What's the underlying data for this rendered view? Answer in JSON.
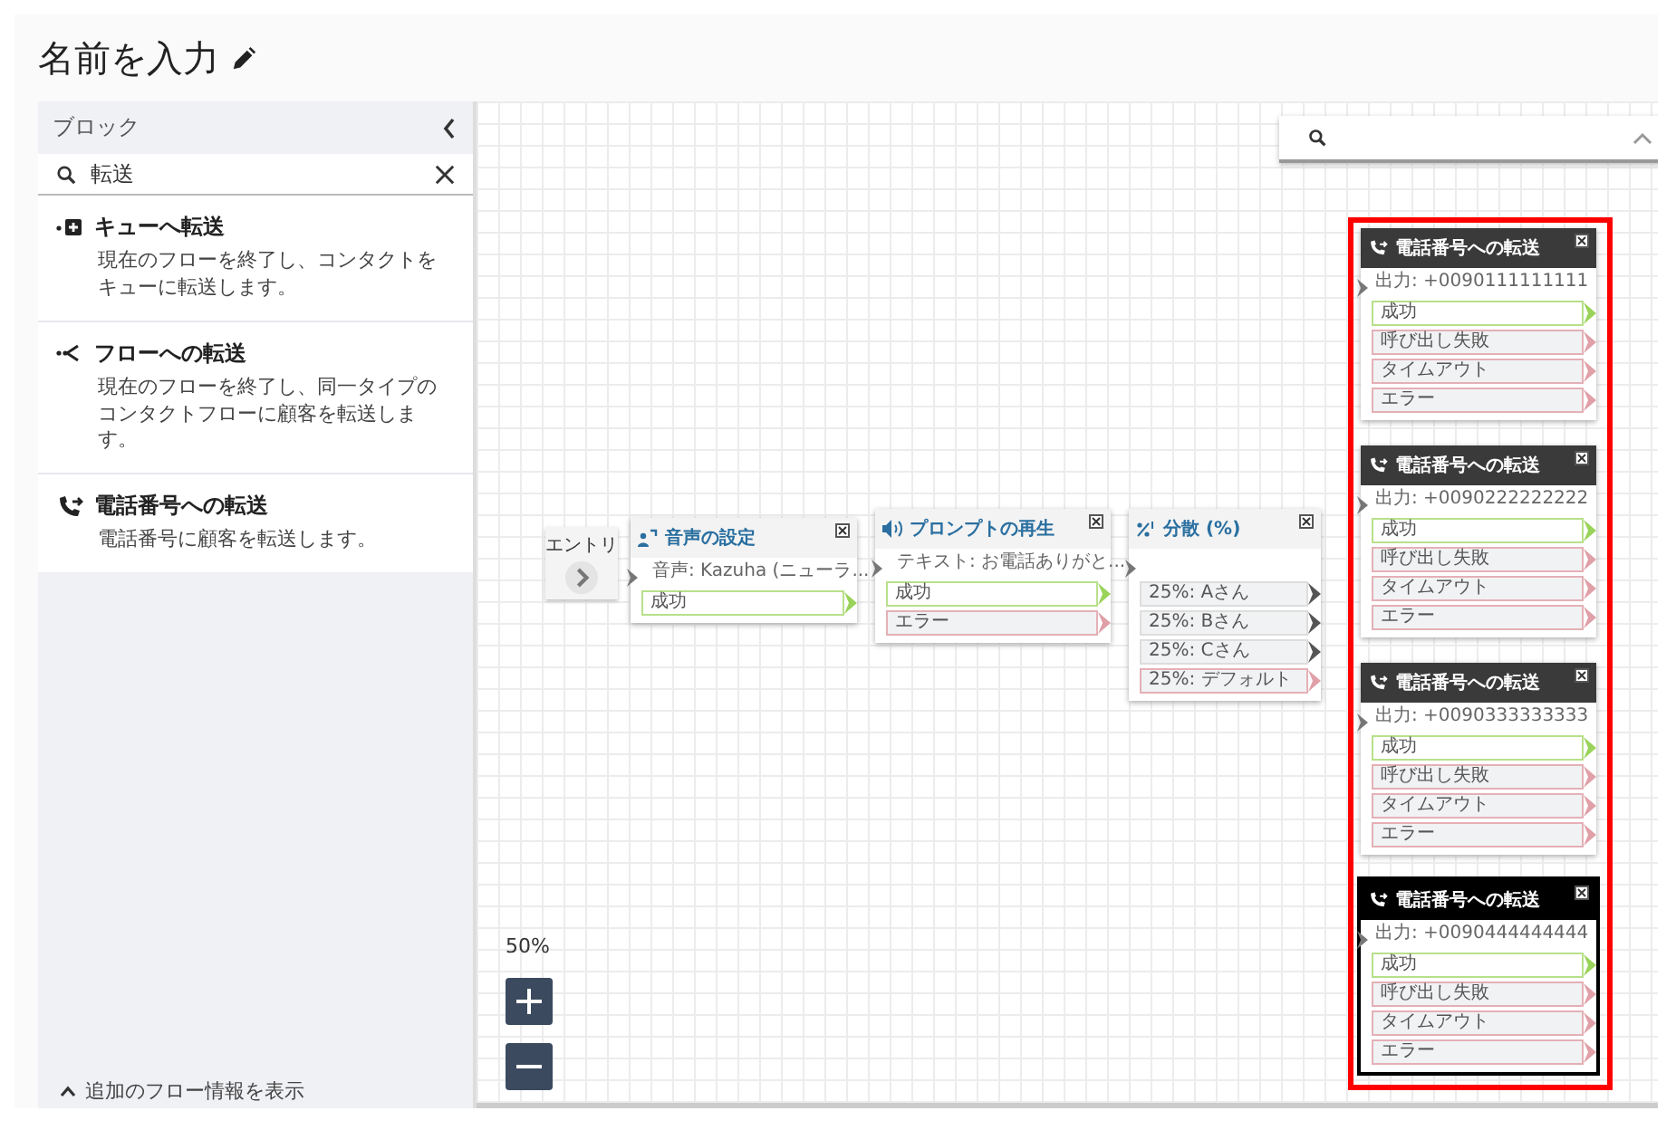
{
  "title": "名前を入力",
  "sidebar": {
    "header": "ブロック",
    "search": {
      "value": "転送"
    },
    "items": [
      {
        "kind": "queue",
        "title": "キューへ転送",
        "description": "現在のフローを終了し、コンタクトをキューに転送します。"
      },
      {
        "kind": "flow",
        "title": "フローへの転送",
        "description": "現在のフローを終了し、同一タイプのコンタクトフローに顧客を転送します。"
      },
      {
        "kind": "phone",
        "title": "電話番号への転送",
        "description": "電話番号に顧客を転送します。"
      }
    ],
    "footer": "追加のフロー情報を表示"
  },
  "canvas": {
    "entry": "エントリ",
    "zoom": "50%",
    "nodes": [
      {
        "kind": "voice",
        "title": "音声の設定",
        "detail": "音声: Kazuha (ニューラ...",
        "selected": false,
        "outputs": [
          {
            "kind": "success",
            "label": "成功"
          }
        ]
      },
      {
        "kind": "prompt",
        "title": "プロンプトの再生",
        "detail": "テキスト: お電話ありがと...",
        "selected": false,
        "outputs": [
          {
            "kind": "success",
            "label": "成功"
          },
          {
            "kind": "error",
            "label": "エラー"
          }
        ]
      },
      {
        "kind": "split",
        "title": "分散 (%)",
        "selected": false,
        "outputs": [
          {
            "kind": "branch",
            "label": "25%: Aさん"
          },
          {
            "kind": "branch",
            "label": "25%: Bさん"
          },
          {
            "kind": "branch",
            "label": "25%: Cさん"
          },
          {
            "kind": "error",
            "label": "25%: デフォルト"
          }
        ]
      },
      {
        "kind": "transfer",
        "title": "電話番号への転送",
        "detail": "出力: +0090111111111",
        "selected": false,
        "outputs": [
          {
            "kind": "success",
            "label": "成功"
          },
          {
            "kind": "error",
            "label": "呼び出し失敗"
          },
          {
            "kind": "error",
            "label": "タイムアウト"
          },
          {
            "kind": "error",
            "label": "エラー"
          }
        ]
      },
      {
        "kind": "transfer",
        "title": "電話番号への転送",
        "detail": "出力: +0090222222222",
        "selected": false,
        "outputs": [
          {
            "kind": "success",
            "label": "成功"
          },
          {
            "kind": "error",
            "label": "呼び出し失敗"
          },
          {
            "kind": "error",
            "label": "タイムアウト"
          },
          {
            "kind": "error",
            "label": "エラー"
          }
        ]
      },
      {
        "kind": "transfer",
        "title": "電話番号への転送",
        "detail": "出力: +0090333333333",
        "selected": false,
        "outputs": [
          {
            "kind": "success",
            "label": "成功"
          },
          {
            "kind": "error",
            "label": "呼び出し失敗"
          },
          {
            "kind": "error",
            "label": "タイムアウト"
          },
          {
            "kind": "error",
            "label": "エラー"
          }
        ]
      },
      {
        "kind": "transfer",
        "title": "電話番号への転送",
        "detail": "出力: +0090444444444",
        "selected": true,
        "outputs": [
          {
            "kind": "success",
            "label": "成功"
          },
          {
            "kind": "error",
            "label": "呼び出し失敗"
          },
          {
            "kind": "error",
            "label": "タイムアウト"
          },
          {
            "kind": "error",
            "label": "エラー"
          }
        ]
      }
    ]
  }
}
